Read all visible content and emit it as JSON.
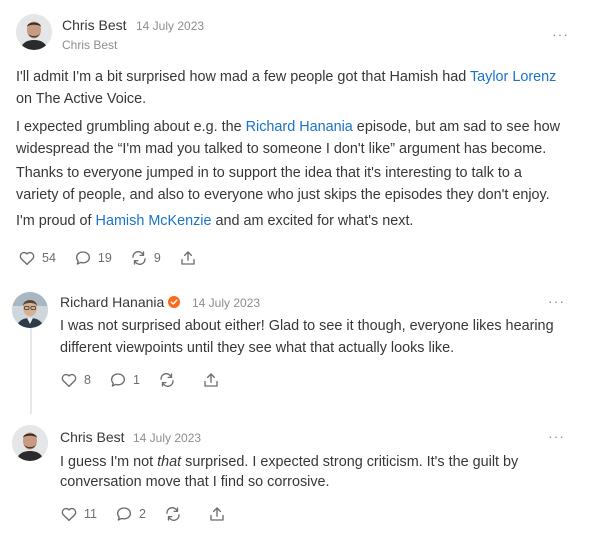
{
  "post": {
    "author": "Chris Best",
    "date": "14 July 2023",
    "handle": "Chris Best",
    "more": "···",
    "line1a": "I'll admit I'm a bit surprised how mad a few people got that Hamish had ",
    "line1link": "Taylor Lorenz",
    "line2": "on The Active Voice.",
    "p2a": "I expected grumbling about e.g. the ",
    "p2link": "Richard Hanania",
    "p2b": " episode, but am sad to see how",
    "p2line2": "widespread the “I'm mad you talked to someone I don't like” argument has become.",
    "p3line1": "Thanks to everyone jumped in to support the idea that it's interesting to talk to a",
    "p3line2": "variety of people, and also to everyone who just skips the episodes they don't enjoy.",
    "p4a": "I'm proud of ",
    "p4link": "Hamish McKenzie",
    "p4b": " and am excited for what's next.",
    "likes": "54",
    "comments": "19",
    "restacks": "9"
  },
  "reply1": {
    "author": "Richard Hanania",
    "date": "14 July 2023",
    "more": "···",
    "line1": "I was not surprised about either! Glad to see it though, everyone likes hearing",
    "line2": "different viewpoints until they see what that actually looks like.",
    "likes": "8",
    "comments": "1"
  },
  "reply2": {
    "author": "Chris Best",
    "date": "14 July 2023",
    "more": "···",
    "line1a": "I guess I'm not ",
    "line1em": "that",
    "line1b": " surprised. I expected strong criticism. It's the guilt by",
    "line2": "conversation move that I find so corrosive.",
    "likes": "11",
    "comments": "2"
  },
  "icons": {
    "like": "heart-icon",
    "comment": "comment-bubble-icon",
    "restack": "restack-arrows-icon",
    "share": "share-upload-icon",
    "verified": "verified-badge-icon"
  },
  "colors": {
    "link": "#1a73c9",
    "badge": "#ff6719",
    "text": "#363737",
    "muted": "#8b8d8f"
  }
}
